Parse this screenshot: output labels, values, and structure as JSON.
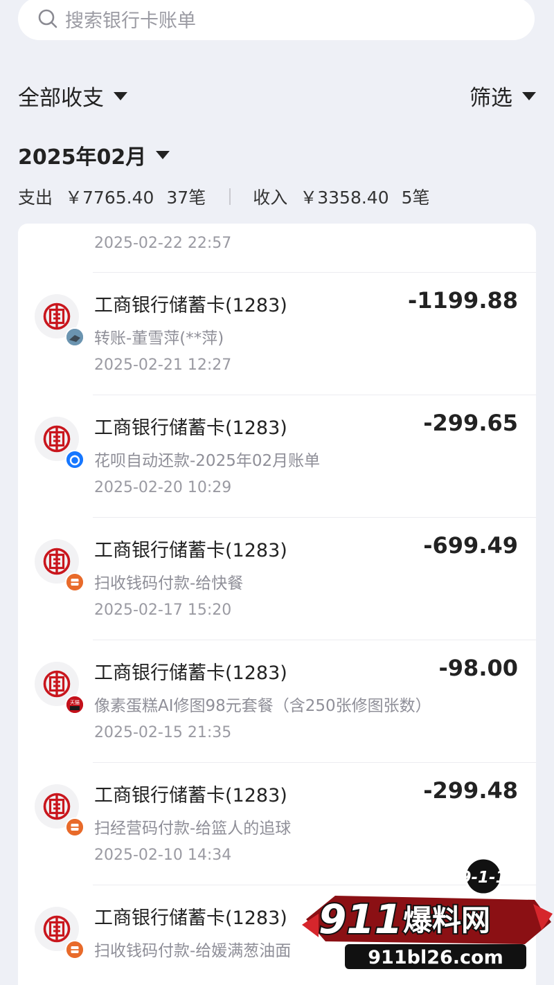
{
  "search": {
    "placeholder": "搜索银行卡账单"
  },
  "filter": {
    "type_label": "全部收支",
    "filter_label": "筛选"
  },
  "month": {
    "label": "2025年02月"
  },
  "summary": {
    "expense_label": "支出",
    "expense_amount": "￥7765.40",
    "expense_count": "37笔",
    "income_label": "收入",
    "income_amount": "￥3358.40",
    "income_count": "5笔"
  },
  "partial_top_date": "2025-02-22 22:57",
  "transactions": [
    {
      "title": "工商银行储蓄卡(1283)",
      "desc": "转账-董雪萍(**萍)",
      "date": "2025-02-21 12:27",
      "amount": "-1199.88",
      "badge_icon": "transfer-avatar-icon"
    },
    {
      "title": "工商银行储蓄卡(1283)",
      "desc": "花呗自动还款-2025年02月账单",
      "date": "2025-02-20 10:29",
      "amount": "-299.65",
      "badge_icon": "huabei-icon"
    },
    {
      "title": "工商银行储蓄卡(1283)",
      "desc": "扫收钱码付款-给快餐",
      "date": "2025-02-17 15:20",
      "amount": "-699.49",
      "badge_icon": "shop-icon"
    },
    {
      "title": "工商银行储蓄卡(1283)",
      "desc": "像素蛋糕AI修图98元套餐（含250张修图张数）",
      "date": "2025-02-15 21:35",
      "amount": "-98.00",
      "badge_icon": "tmall-icon",
      "badge_text": "天猫"
    },
    {
      "title": "工商银行储蓄卡(1283)",
      "desc": "扫经营码付款-给篮人的追球",
      "date": "2025-02-10 14:34",
      "amount": "-299.48",
      "badge_icon": "shop-icon"
    },
    {
      "title": "工商银行储蓄卡(1283)",
      "desc": "扫收钱码付款-给媛满葱油面",
      "date": "",
      "amount": "",
      "badge_icon": "shop-icon"
    }
  ],
  "watermark": {
    "top_text": "9-1-1",
    "brand_num": "911",
    "brand_cn": "爆料网",
    "url": "911bl26.com"
  },
  "colors": {
    "icbc_red": "#c9161d",
    "shop_orange": "#e86a2a",
    "huabei_blue": "#1677ff",
    "tmall_red": "#c4111b"
  }
}
